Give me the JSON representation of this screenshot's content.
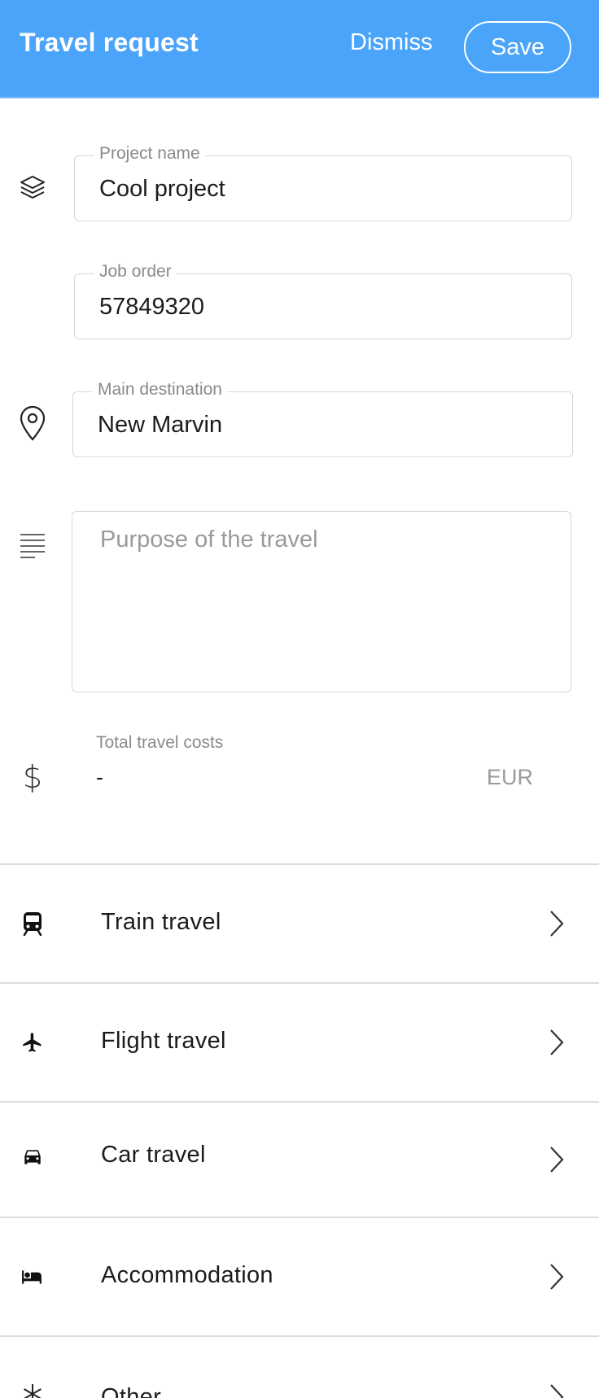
{
  "header": {
    "title": "Travel request",
    "dismiss_label": "Dismiss",
    "save_label": "Save",
    "background_color": "#4aa4fa"
  },
  "form": {
    "project_name": {
      "label": "Project name",
      "value": "Cool project",
      "icon": "layers-icon"
    },
    "job_order": {
      "label": "Job order",
      "value": "57849320"
    },
    "main_destination": {
      "label": "Main destination",
      "value": "New Marvin",
      "icon": "location-pin-icon"
    },
    "purpose": {
      "placeholder": "Purpose of the travel",
      "icon": "notes-icon"
    },
    "total_costs": {
      "label": "Total travel costs",
      "value": "-",
      "currency": "EUR",
      "icon": "dollar-icon"
    }
  },
  "categories": [
    {
      "label": "Train travel",
      "icon": "train-icon"
    },
    {
      "label": "Flight travel",
      "icon": "airplane-icon"
    },
    {
      "label": "Car travel",
      "icon": "car-icon"
    },
    {
      "label": "Accommodation",
      "icon": "bed-icon"
    },
    {
      "label": "Other",
      "icon": "asterisk-icon"
    }
  ]
}
